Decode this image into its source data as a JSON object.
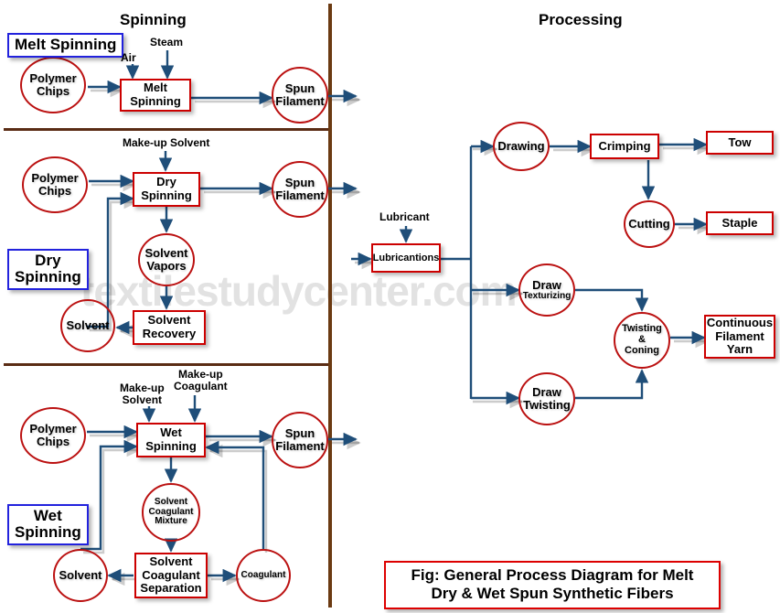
{
  "figure": {
    "column_titles": {
      "spinning": "Spinning",
      "processing": "Processing"
    },
    "caption_line1": "Fig: General Process Diagram for Melt",
    "caption_line2": "Dry & Wet Spun Synthetic Fibers",
    "watermark": "textilestudycenter.com",
    "colors": {
      "box_border": "#cc0000",
      "circle_border": "#bb1111",
      "arrow": "#1f4e79",
      "section_tag_border": "#2222dd",
      "divider": "#6b3a12",
      "watermark": "#e2e2e2"
    }
  },
  "sections": {
    "melt": {
      "tag": "Melt Spinning",
      "input_circle": "Polymer Chips",
      "input_circle_l1": "Polymer",
      "input_circle_l2": "Chips",
      "process_box_l1": "Melt",
      "process_box_l2": "Spinning",
      "annotations": {
        "air": "Air",
        "steam": "Steam"
      },
      "output_circle_l1": "Spun",
      "output_circle_l2": "Filament"
    },
    "dry": {
      "tag_l1": "Dry",
      "tag_l2": "Spinning",
      "input_circle_l1": "Polymer",
      "input_circle_l2": "Chips",
      "process_box_l1": "Dry",
      "process_box_l2": "Spinning",
      "annotations": {
        "makeup_solvent": "Make-up Solvent"
      },
      "output_circle_l1": "Spun",
      "output_circle_l2": "Filament",
      "vapors_circle_l1": "Solvent",
      "vapors_circle_l2": "Vapors",
      "recovery_box_l1": "Solvent",
      "recovery_box_l2": "Recovery",
      "solvent_circle": "Solvent"
    },
    "wet": {
      "tag_l1": "Wet",
      "tag_l2": "Spinning",
      "input_circle_l1": "Polymer",
      "input_circle_l2": "Chips",
      "process_box_l1": "Wet",
      "process_box_l2": "Spinning",
      "annotations": {
        "makeup_solvent_l1": "Make-up",
        "makeup_solvent_l2": "Solvent",
        "makeup_coagulant_l1": "Make-up",
        "makeup_coagulant_l2": "Coagulant"
      },
      "output_circle_l1": "Spun",
      "output_circle_l2": "Filament",
      "mixture_circle_l1": "Solvent",
      "mixture_circle_l2": "Coagulant",
      "mixture_circle_l3": "Mixture",
      "separation_box_l1": "Solvent",
      "separation_box_l2": "Coagulant",
      "separation_box_l3": "Separation",
      "solvent_circle": "Solvent",
      "coagulant_circle": "Coagulant"
    },
    "processing": {
      "lubricant_label": "Lubricant",
      "lubrications_box": "Lubricantions",
      "drawing_circle": "Drawing",
      "crimping_box": "Crimping",
      "tow_box": "Tow",
      "cutting_circle": "Cutting",
      "staple_box": "Staple",
      "draw_texturizing_l1": "Draw",
      "draw_texturizing_l2": "Texturizing",
      "draw_twisting_l1": "Draw",
      "draw_twisting_l2": "Twisting",
      "twisting_coning_l1": "Twisting",
      "twisting_coning_l2": "&",
      "twisting_coning_l3": "Coning",
      "cfy_box_l1": "Continuous",
      "cfy_box_l2": "Filament",
      "cfy_box_l3": "Yarn"
    }
  }
}
